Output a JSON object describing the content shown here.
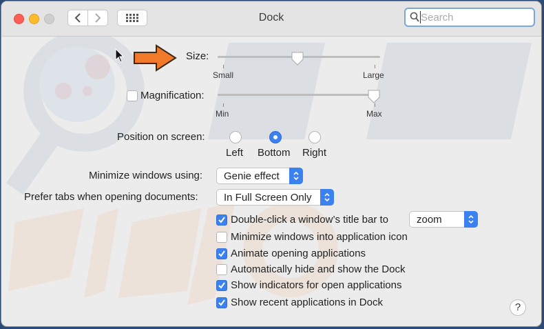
{
  "window": {
    "title": "Dock"
  },
  "search": {
    "placeholder": "Search"
  },
  "size": {
    "label": "Size:",
    "min_label": "Small",
    "max_label": "Large",
    "value": 0.5
  },
  "magnification": {
    "label": "Magnification:",
    "min_label": "Min",
    "max_label": "Max",
    "checked": false,
    "value": 1.0
  },
  "position": {
    "label": "Position on screen:",
    "options": [
      "Left",
      "Bottom",
      "Right"
    ],
    "selected": "Bottom"
  },
  "minimize": {
    "label": "Minimize windows using:",
    "value": "Genie effect"
  },
  "prefer_tabs": {
    "label": "Prefer tabs when opening documents:",
    "value": "In Full Screen Only"
  },
  "checkboxes": [
    {
      "label": "Double-click a window’s title bar to",
      "checked": true
    },
    {
      "label": "Minimize windows into application icon",
      "checked": false
    },
    {
      "label": "Animate opening applications",
      "checked": true
    },
    {
      "label": "Automatically hide and show the Dock",
      "checked": false
    },
    {
      "label": "Show indicators for open applications",
      "checked": true
    },
    {
      "label": "Show recent applications in Dock",
      "checked": true
    }
  ],
  "double_click_action": {
    "value": "zoom"
  },
  "help": {
    "label": "?"
  },
  "colors": {
    "accent": "#3b82f0",
    "arrow": "#f07a2a"
  }
}
